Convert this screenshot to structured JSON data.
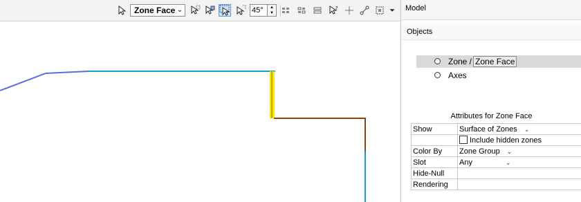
{
  "toolbar": {
    "zone_select": "Zone Face",
    "angle_value": "45°",
    "icons": [
      "pointer-icon",
      "select-face-icon",
      "select-region-icon",
      "select-box-icon",
      "select-zone-icon",
      "grid-a-icon",
      "grid-b-icon",
      "grid-c-icon",
      "help-pointer-icon",
      "crosshair-icon",
      "link-icon",
      "view-options-icon",
      "overflow-arrow-icon"
    ]
  },
  "canvas": {
    "colors": {
      "blue_line": "#5b6bde",
      "cyan_line": "#1a9cd8",
      "yellow_face": "#ffe600",
      "brown_line": "#8b4513",
      "teal_line": "#1aa0b0"
    }
  },
  "panel": {
    "model_title": "Model",
    "objects_title": "Objects",
    "tree": [
      {
        "prefix": "Zone /",
        "label": "Zone Face",
        "selected": true
      },
      {
        "label": "Axes",
        "selected": false
      }
    ],
    "attributes_title": "Attributes for Zone Face",
    "attributes": {
      "show_label": "Show",
      "show_value": "Surface of Zones",
      "include_hidden": "Include hidden zones",
      "color_by_label": "Color By",
      "color_by_value": "Zone Group",
      "slot_label": "Slot",
      "slot_value": "Any",
      "hide_null_label": "Hide-Null",
      "rendering_label": "Rendering"
    }
  }
}
